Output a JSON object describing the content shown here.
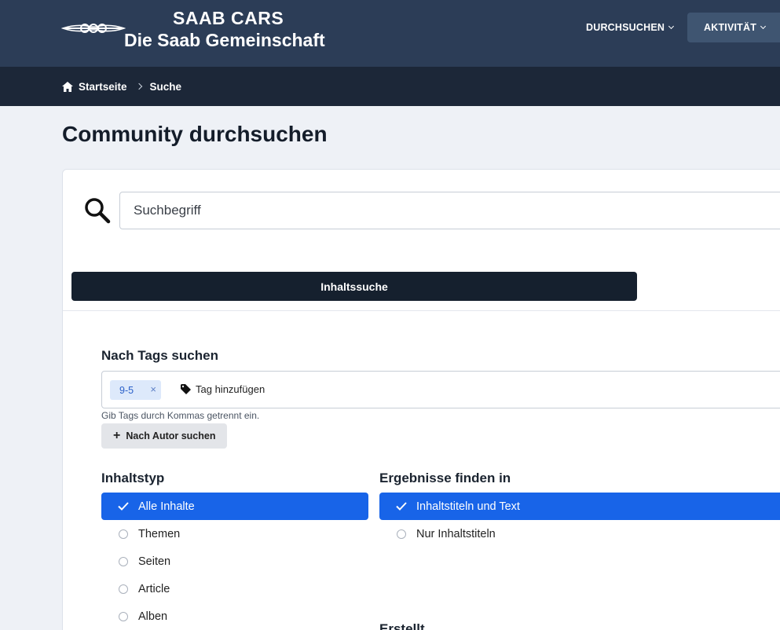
{
  "header": {
    "logo_line1": "SAAB CARS",
    "logo_line2": "Die Saab Gemeinschaft",
    "nav": [
      {
        "label": "DURCHSUCHEN"
      },
      {
        "label": "AKTIVITÄT"
      }
    ]
  },
  "breadcrumb": {
    "home": "Startseite",
    "current": "Suche"
  },
  "page": {
    "title": "Community durchsuchen"
  },
  "search": {
    "placeholder": "Suchbegriff",
    "tab_label": "Inhaltssuche"
  },
  "tags": {
    "label": "Nach Tags suchen",
    "chip": "9-5",
    "chip_remove": "×",
    "add_label": "Tag hinzufügen",
    "hint": "Gib Tags durch Kommas getrennt ein."
  },
  "author": {
    "button_label": "Nach Autor suchen"
  },
  "content_type": {
    "label": "Inhaltstyp",
    "options": [
      {
        "label": "Alle Inhalte",
        "selected": true
      },
      {
        "label": "Themen",
        "selected": false
      },
      {
        "label": "Seiten",
        "selected": false
      },
      {
        "label": "Article",
        "selected": false
      },
      {
        "label": "Alben",
        "selected": false
      }
    ]
  },
  "find_in": {
    "label": "Ergebnisse finden in",
    "options": [
      {
        "label": "Inhaltstiteln und Text",
        "selected": true
      },
      {
        "label": "Nur Inhaltstiteln",
        "selected": false
      }
    ]
  },
  "created": {
    "label": "Erstellt"
  },
  "colors": {
    "header_bg": "#2c3d57",
    "breadcrumb_bg": "#1c2738",
    "accent": "#1864e8",
    "tab_bg": "#15202e"
  }
}
